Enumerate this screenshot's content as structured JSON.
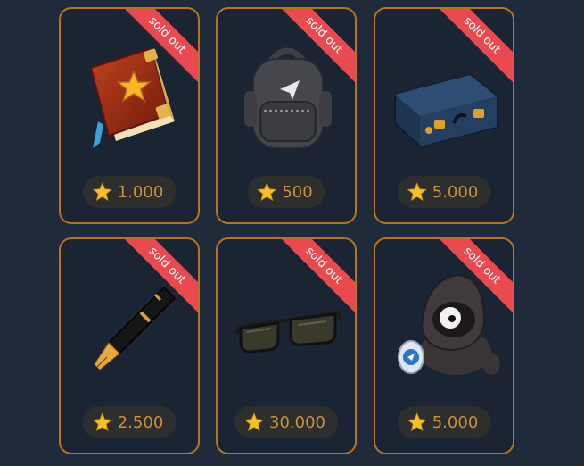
{
  "status_label": "sold out",
  "items": [
    {
      "icon": "spellbook-icon",
      "price": "1.000"
    },
    {
      "icon": "backpack-icon",
      "price": "500"
    },
    {
      "icon": "briefcase-icon",
      "price": "5.000"
    },
    {
      "icon": "fountain-pen-icon",
      "price": "2.500"
    },
    {
      "icon": "sunglasses-icon",
      "price": "30.000"
    },
    {
      "icon": "hooded-plush-icon",
      "price": "5.000"
    }
  ],
  "colors": {
    "card_border": "#b8731f",
    "ribbon": "#e84a4f",
    "price_text": "#c99042",
    "background": "#1f2a3b"
  }
}
